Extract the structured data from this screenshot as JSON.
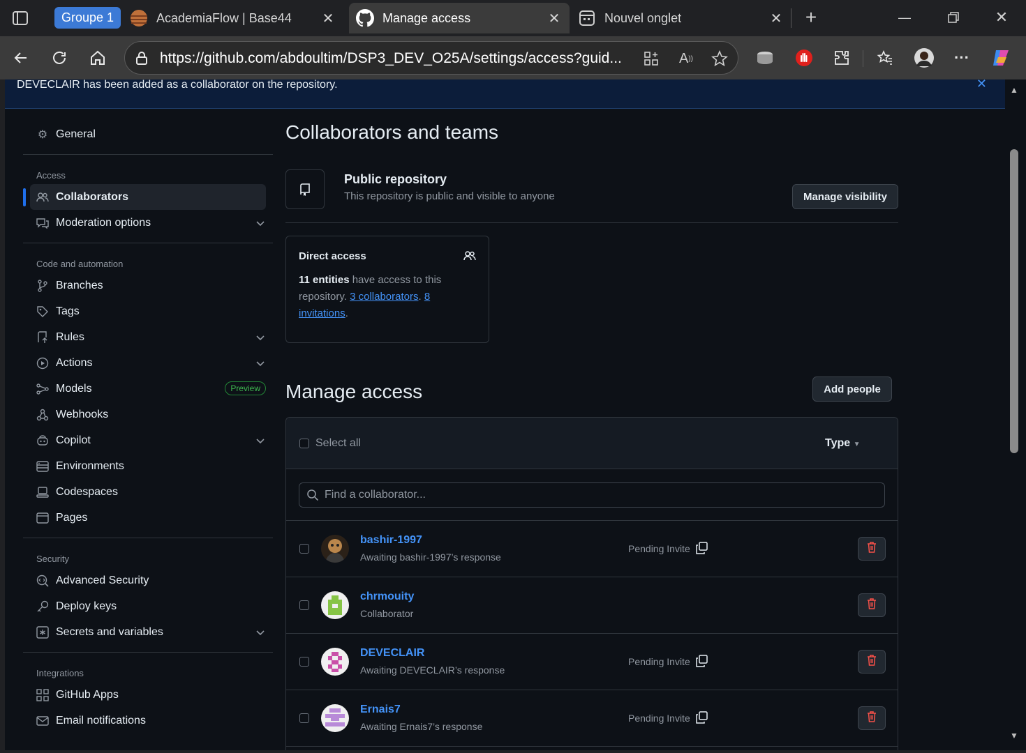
{
  "browser": {
    "tab_group_label": "Groupe 1",
    "tabs": [
      {
        "title": "AcademiaFlow | Base44"
      },
      {
        "title": "Manage access"
      },
      {
        "title": "Nouvel onglet"
      }
    ],
    "url": "https://github.com/abdoultim/DSP3_DEV_O25A/settings/access?guid..."
  },
  "flash": {
    "message": "DEVECLAIR has been added as a collaborator on the repository."
  },
  "sidebar": {
    "general": "General",
    "access_heading": "Access",
    "collaborators": "Collaborators",
    "moderation": "Moderation options",
    "code_heading": "Code and automation",
    "branches": "Branches",
    "tags": "Tags",
    "rules": "Rules",
    "actions": "Actions",
    "models": "Models",
    "preview_badge": "Preview",
    "webhooks": "Webhooks",
    "copilot": "Copilot",
    "environments": "Environments",
    "codespaces": "Codespaces",
    "pages": "Pages",
    "security_heading": "Security",
    "advanced_security": "Advanced Security",
    "deploy_keys": "Deploy keys",
    "secrets": "Secrets and variables",
    "integrations_heading": "Integrations",
    "github_apps": "GitHub Apps",
    "email_notifications": "Email notifications"
  },
  "main": {
    "title": "Collaborators and teams",
    "repo_title": "Public repository",
    "repo_sub": "This repository is public and visible to anyone",
    "manage_visibility": "Manage visibility",
    "direct_access_title": "Direct access",
    "direct_count": "11 entities",
    "direct_text": " have access to this repository. ",
    "collaborators_link": "3 collaborators",
    "invitations_link": "8 invitations",
    "manage_access_title": "Manage access",
    "add_people": "Add people",
    "select_all": "Select all",
    "type_filter": "Type",
    "search_placeholder": "Find a collaborator...",
    "pending_label": "Pending Invite",
    "rows": [
      {
        "name": "bashir-1997",
        "sub": "Awaiting bashir-1997’s response",
        "pending": true
      },
      {
        "name": "chrmouity",
        "sub": "Collaborator",
        "pending": false
      },
      {
        "name": "DEVECLAIR",
        "sub": "Awaiting DEVECLAIR’s response",
        "pending": true
      },
      {
        "name": "Ernais7",
        "sub": "Awaiting Ernais7’s response",
        "pending": true
      }
    ]
  },
  "colors": {
    "accent": "#4493f8",
    "danger": "#f85149",
    "bg": "#0d1117"
  }
}
